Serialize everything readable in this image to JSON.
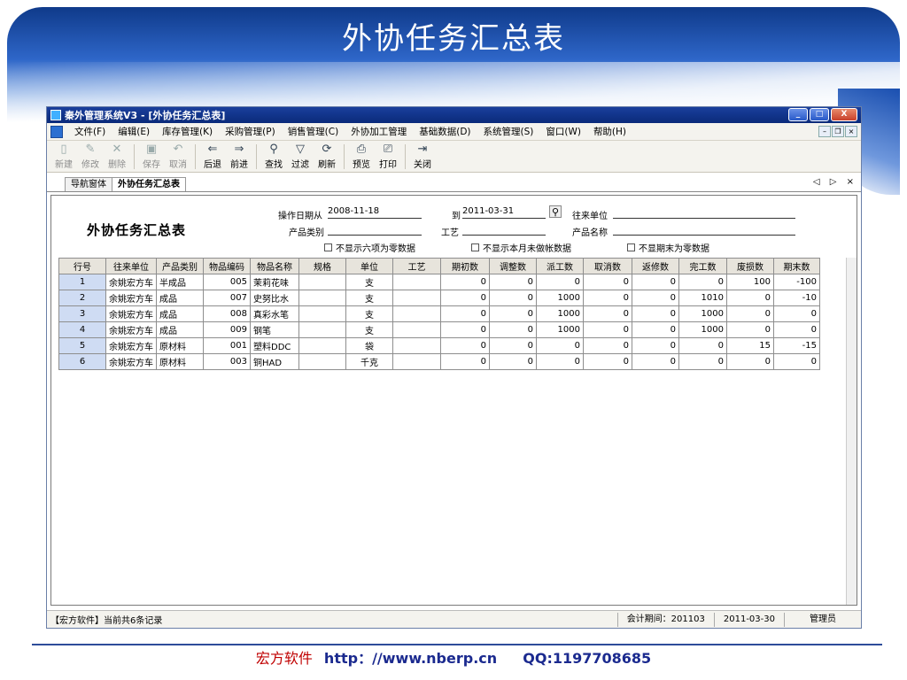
{
  "slide": {
    "title": "外协任务汇总表",
    "footer_company": "宏方软件",
    "footer_url": "http：//www.nberp.cn",
    "footer_qq": "QQ:1197708685"
  },
  "window": {
    "title": "秦外管理系统V3 - [外协任务汇总表]",
    "controls": [
      "_",
      "□",
      "X"
    ]
  },
  "menu": {
    "items": [
      "文件(F)",
      "编辑(E)",
      "库存管理(K)",
      "采购管理(P)",
      "销售管理(C)",
      "外协加工管理",
      "基础数据(D)",
      "系统管理(S)",
      "窗口(W)",
      "帮助(H)"
    ]
  },
  "toolbar": {
    "groups": [
      [
        {
          "label": "新建",
          "icon": "new-icon",
          "glyph": "▯",
          "disabled": true
        },
        {
          "label": "修改",
          "icon": "edit-icon",
          "glyph": "✎",
          "disabled": true
        },
        {
          "label": "删除",
          "icon": "delete-icon",
          "glyph": "✕",
          "disabled": true
        }
      ],
      [
        {
          "label": "保存",
          "icon": "save-icon",
          "glyph": "▣",
          "disabled": true
        },
        {
          "label": "取消",
          "icon": "cancel-icon",
          "glyph": "↶",
          "disabled": true
        }
      ],
      [
        {
          "label": "后退",
          "icon": "back-icon",
          "glyph": "⇐",
          "disabled": false
        },
        {
          "label": "前进",
          "icon": "forward-icon",
          "glyph": "⇒",
          "disabled": false
        }
      ],
      [
        {
          "label": "查找",
          "icon": "find-icon",
          "glyph": "⚲",
          "disabled": false
        },
        {
          "label": "过滤",
          "icon": "filter-icon",
          "glyph": "▽",
          "disabled": false
        },
        {
          "label": "刷新",
          "icon": "refresh-icon",
          "glyph": "⟳",
          "disabled": false
        }
      ],
      [
        {
          "label": "预览",
          "icon": "preview-icon",
          "glyph": "⎙",
          "disabled": false
        },
        {
          "label": "打印",
          "icon": "print-icon",
          "glyph": "⎚",
          "disabled": false
        }
      ],
      [
        {
          "label": "关闭",
          "icon": "close-door-icon",
          "glyph": "⇥",
          "disabled": false
        }
      ]
    ]
  },
  "tabs": {
    "items": [
      "导航窗体",
      "外协任务汇总表"
    ],
    "active": 1,
    "nav": "◁ ▷ ×"
  },
  "form": {
    "title": "外协任务汇总表",
    "op_date_label": "操作日期从",
    "op_date_from": "2008-11-18",
    "to_label": "到",
    "op_date_to": "2011-03-31",
    "partner_label": "往来单位",
    "partner_value": "",
    "category_label": "产品类别",
    "category_value": "",
    "process_label": "工艺",
    "process_value": "",
    "product_name_label": "产品名称",
    "product_name_value": "",
    "chk1": "不显示六项为零数据",
    "chk2": "不显示本月未做帐数据",
    "chk3": "不显期末为零数据"
  },
  "grid": {
    "columns": [
      "行号",
      "往来单位",
      "产品类别",
      "物品编码",
      "物品名称",
      "规格",
      "单位",
      "工艺",
      "期初数",
      "调整数",
      "派工数",
      "取消数",
      "返修数",
      "完工数",
      "废损数",
      "期末数"
    ],
    "rows": [
      [
        "1",
        "余姚宏方车",
        "半成品",
        "005",
        "茉莉花味 ",
        "",
        "支",
        "",
        "0",
        "0",
        "0",
        "0",
        "0",
        "0",
        "100",
        "-100"
      ],
      [
        "2",
        "余姚宏方车",
        "成品",
        "007",
        "史努比水 ",
        "",
        "支",
        "",
        "0",
        "0",
        "1000",
        "0",
        "0",
        "1010",
        "0",
        "-10"
      ],
      [
        "3",
        "余姚宏方车",
        "成品",
        "008",
        "真彩水笔",
        "",
        "支",
        "",
        "0",
        "0",
        "1000",
        "0",
        "0",
        "1000",
        "0",
        "0"
      ],
      [
        "4",
        "余姚宏方车",
        "成品",
        "009",
        "钢笔",
        "",
        "支",
        "",
        "0",
        "0",
        "1000",
        "0",
        "0",
        "1000",
        "0",
        "0"
      ],
      [
        "5",
        "余姚宏方车",
        "原材料",
        "001",
        "塑料DDC",
        "",
        "袋",
        "",
        "0",
        "0",
        "0",
        "0",
        "0",
        "0",
        "15",
        "-15"
      ],
      [
        "6",
        "余姚宏方车",
        "原材料",
        "003",
        "铜HAD",
        "",
        "千克",
        "",
        "0",
        "0",
        "0",
        "0",
        "0",
        "0",
        "0",
        "0"
      ]
    ]
  },
  "status": {
    "left": "【宏方软件】当前共6条记录",
    "period": "会计期间：201103",
    "date": "2011-03-30",
    "user": "管理员"
  }
}
